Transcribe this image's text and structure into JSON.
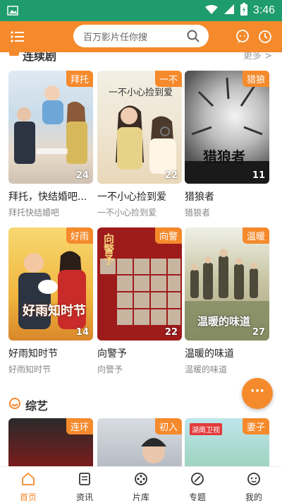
{
  "status_bar": {
    "time": "3:46"
  },
  "header": {
    "search_placeholder": "百万影片任你搜"
  },
  "sections": [
    {
      "title": "连续剧",
      "more": "更多 >"
    },
    {
      "title": "综艺"
    }
  ],
  "dramas": [
    {
      "tag": "拜托",
      "count": "24",
      "title": "拜托，快结婚吧...",
      "subtitle": "拜托快结婚吧",
      "poster_text": ""
    },
    {
      "tag": "一不",
      "count": "22",
      "title": "一不小心捡到爱",
      "subtitle": "一不小心捡到爱",
      "poster_text": "一不小心捡到爱"
    },
    {
      "tag": "猎狼",
      "count": "11",
      "title": "猎狼者",
      "subtitle": "猎狼者",
      "poster_text": "猎狼者"
    },
    {
      "tag": "好雨",
      "count": "14",
      "title": "好雨知时节",
      "subtitle": "好雨知时节",
      "poster_text": "好雨知时节"
    },
    {
      "tag": "向警",
      "count": "22",
      "title": "向警予",
      "subtitle": "向警予",
      "poster_text": "向警予"
    },
    {
      "tag": "温暖",
      "count": "27",
      "title": "温暖的味道",
      "subtitle": "温暖的味道",
      "poster_text": "温暖的味道"
    }
  ],
  "variety": [
    {
      "tag": "连环",
      "badge": ""
    },
    {
      "tag": "初入",
      "badge": ""
    },
    {
      "tag": "妻子",
      "badge": "湖南卫视"
    }
  ],
  "fab": {
    "label": "···"
  },
  "tabs": [
    {
      "label": "首页",
      "icon": "home-icon",
      "active": true
    },
    {
      "label": "资讯",
      "icon": "news-icon",
      "active": false
    },
    {
      "label": "片库",
      "icon": "film-library-icon",
      "active": false
    },
    {
      "label": "专题",
      "icon": "topic-icon",
      "active": false
    },
    {
      "label": "我的",
      "icon": "profile-icon",
      "active": false
    }
  ],
  "colors": {
    "accent": "#f58a2c",
    "status_bar": "#1e9c6e"
  }
}
